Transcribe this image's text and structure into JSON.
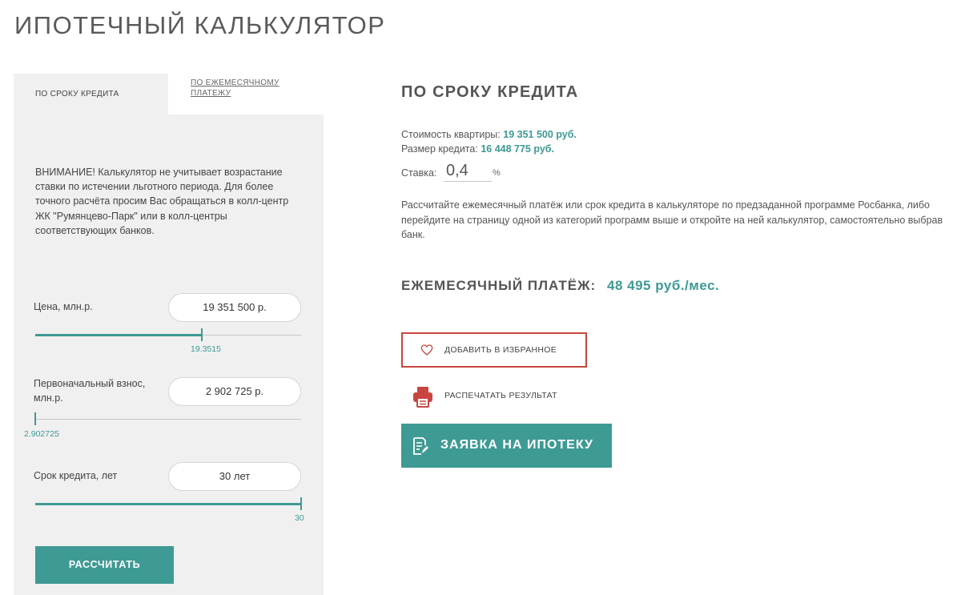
{
  "page": {
    "title": "ИПОТЕЧНЫЙ КАЛЬКУЛЯТОР"
  },
  "tabs": {
    "active": "ПО СРОКУ КРЕДИТА",
    "inactive": "ПО ЕЖЕМЕСЯЧНОМУ ПЛАТЕЖУ"
  },
  "calculator": {
    "warning": "ВНИМАНИЕ! Калькулятор не учитывает возрастание ставки по истечении льготного периода. Для более точного расчёта просим Вас обращаться в колл-центр ЖК \"Румянцево-Парк\" или в колл-центры соответствующих банков.",
    "price": {
      "label": "Цена, млн.р.",
      "value": "19 351 500 р.",
      "slider_value": "19.3515",
      "slider_level": 0.625
    },
    "down_payment": {
      "label": "Первоначальный взнос, млн.р.",
      "value": "2 902 725 р.",
      "slider_value": "2.902725",
      "slider_level": 0.0
    },
    "term": {
      "label": "Срок кредита, лет",
      "value": "30 лет",
      "slider_value": "30",
      "slider_level": 1.0
    },
    "calculate_button": "РАССЧИТАТЬ"
  },
  "result": {
    "title": "ПО СРОКУ КРЕДИТА",
    "cost_label": "Стоимость квартиры:",
    "cost_value": "19 351 500 руб.",
    "loan_label": "Размер кредита:",
    "loan_value": "16 448 775 руб.",
    "rate_label": "Ставка:",
    "rate_value": "0,4",
    "rate_unit": "%",
    "description": "Рассчитайте ежемесячный платёж или срок кредита в калькуляторе по предзаданной программе Росбанка, либо перейдите на страницу одной из категорий программ выше и откройте на ней калькулятор, самостоятельно выбрав банк.",
    "monthly_label": "ЕЖЕМЕСЯЧНЫЙ ПЛАТЁЖ:",
    "monthly_value": "48 495 руб./мес."
  },
  "actions": {
    "favorite": "ДОБАВИТЬ В ИЗБРАННОЕ",
    "print": "РАСПЕЧАТАТЬ РЕЗУЛЬТАТ",
    "apply": "ЗАЯВКА НА ИПОТЕКУ"
  },
  "colors": {
    "accent": "#3e9a94",
    "favorite_border": "#c8463f",
    "panel_bg": "#f0f0f0"
  },
  "icons": {
    "favorite": "heart-icon",
    "print": "printer-icon",
    "apply": "document-edit-icon"
  }
}
